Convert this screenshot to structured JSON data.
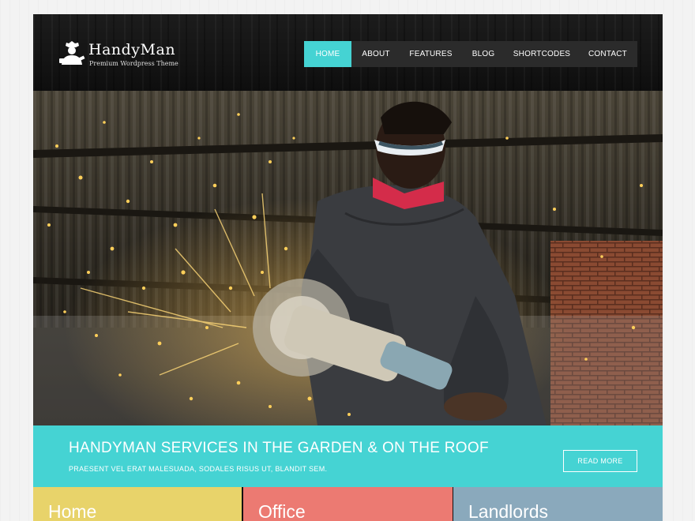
{
  "logo": {
    "name": "HandyMan",
    "tagline": "Premium Wordpress Theme",
    "icon": "handyman-logo-icon"
  },
  "nav": {
    "items": [
      {
        "label": "HOME",
        "active": true
      },
      {
        "label": "ABOUT",
        "active": false
      },
      {
        "label": "FEATURES",
        "active": false
      },
      {
        "label": "BLOG",
        "active": false
      },
      {
        "label": "SHORTCODES",
        "active": false
      },
      {
        "label": "CONTACT",
        "active": false
      }
    ]
  },
  "banner": {
    "title": "HANDYMAN SERVICES IN THE GARDEN & ON THE ROOF",
    "subtitle": "PRAESENT VEL ERAT MALESUADA, SODALES RISUS UT, BLANDIT SEM.",
    "button_label": "READ MORE"
  },
  "tiles": [
    {
      "label": "Home",
      "color": "#e8d36a"
    },
    {
      "label": "Office",
      "color": "#ec7a72"
    },
    {
      "label": "Landlords",
      "color": "#8aa9bc"
    }
  ],
  "colors": {
    "accent": "#45d3d3",
    "header_bg": "#141414",
    "nav_bg": "#2b2b2b"
  }
}
